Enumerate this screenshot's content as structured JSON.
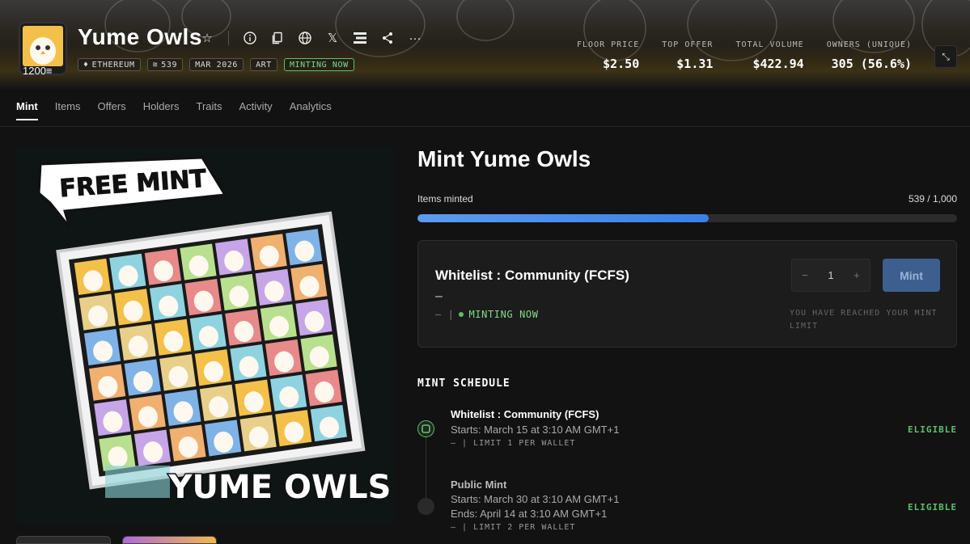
{
  "collection": {
    "name": "Yume Owls",
    "avatar_count": "1200",
    "tags": [
      {
        "label": "ETHEREUM",
        "icon": "ethereum-icon"
      },
      {
        "label": "539",
        "icon": "stack-icon"
      },
      {
        "label": "MAR 2026"
      },
      {
        "label": "ART"
      },
      {
        "label": "MINTING NOW",
        "status": "green"
      }
    ]
  },
  "stats": [
    {
      "label": "FLOOR PRICE",
      "value": "$2.50"
    },
    {
      "label": "TOP OFFER",
      "value": "$1.31"
    },
    {
      "label": "TOTAL VOLUME",
      "value": "$422.94"
    },
    {
      "label": "OWNERS (UNIQUE)",
      "value": "305 (56.6%)"
    }
  ],
  "nav": [
    "Mint",
    "Items",
    "Offers",
    "Holders",
    "Traits",
    "Activity",
    "Analytics"
  ],
  "hero": {
    "top_text": "FREE MINT",
    "bottom_text": "YUME OWLS"
  },
  "mint": {
    "title": "Mint Yume Owls",
    "items_minted_label": "Items minted",
    "items_minted_count": "539 / 1,000",
    "progress_fraction": 0.539
  },
  "whitelist_card": {
    "title": "Whitelist : Community (FCFS)",
    "dash": "–",
    "status_prefix": "– |",
    "status": "MINTING NOW",
    "quantity": "1",
    "minus": "−",
    "plus": "+",
    "mint_button": "Mint",
    "limit_note": "YOU HAVE REACHED YOUR MINT LIMIT"
  },
  "schedule": {
    "heading": "MINT SCHEDULE",
    "phases": [
      {
        "name": "Whitelist : Community (FCFS)",
        "starts": "Starts: March 15 at 3:10 AM GMT+1",
        "limit": "– | LIMIT 1 PER WALLET",
        "eligibility": "ELIGIBLE"
      },
      {
        "name": "Public Mint",
        "starts": "Starts: March 30 at 3:10 AM GMT+1",
        "ends": "Ends: April 14 at 3:10 AM GMT+1",
        "limit": "– | LIMIT 2 PER WALLET",
        "eligibility": "ELIGIBLE"
      }
    ]
  },
  "colors": {
    "accent_green": "#5fbf6b",
    "progress_blue": "#4a8be8",
    "background": "#121212"
  }
}
